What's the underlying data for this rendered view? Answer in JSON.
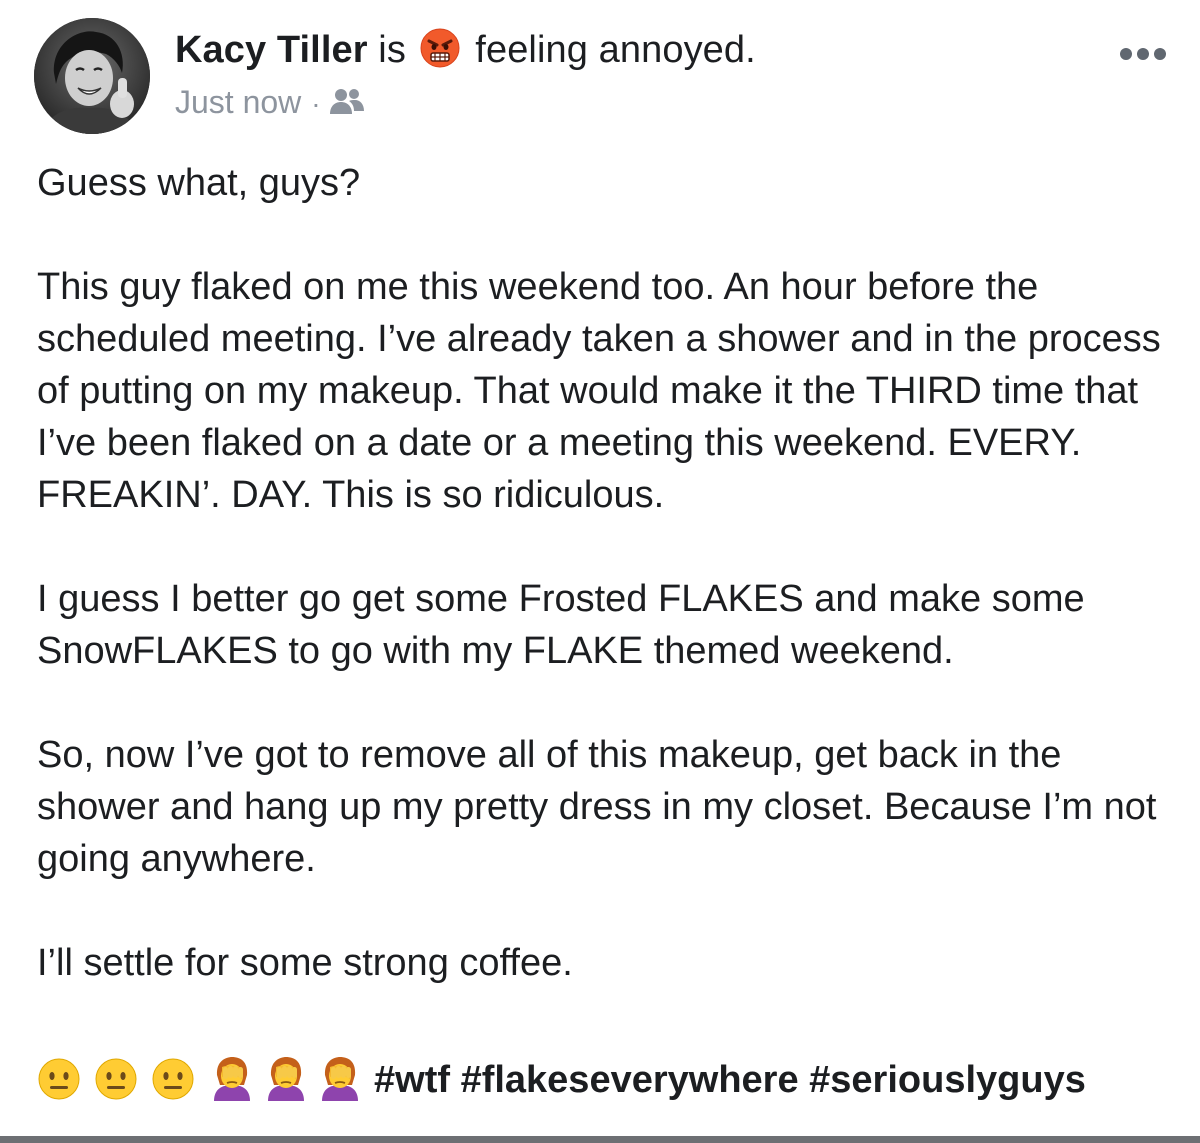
{
  "post": {
    "author": "Kacy Tiller",
    "feeling_prefix": "is",
    "feeling_text": "feeling annoyed.",
    "timestamp": "Just now",
    "separator": "·",
    "audience_icon": "friends-icon",
    "feeling_icon": "angry-face-emoji",
    "more_icon": "more-options-icon",
    "paragraphs": [
      "Guess what, guys?",
      "This guy flaked on me this weekend too. An hour before the scheduled meeting. I’ve already taken a shower and in the process of putting on my makeup. That would make it the THIRD time that I’ve been flaked on a date or a meeting this weekend. EVERY. FREAKIN’. DAY. This is so ridiculous.",
      "I guess I better go get some Frosted FLAKES and make some SnowFLAKES to go with my FLAKE themed weekend.",
      "So, now I’ve got to remove all of this makeup, get back in the shower and hang up my pretty dress in my closet. Because I’m not going anywhere.",
      "I’ll settle for some strong coffee."
    ],
    "final_emojis": [
      "neutral-face",
      "neutral-face",
      "neutral-face",
      "woman-facepalming",
      "woman-facepalming",
      "woman-facepalming"
    ],
    "hashtags": [
      "#wtf",
      "#flakeseverywhere",
      "#seriouslyguys"
    ]
  },
  "colors": {
    "text": "#1c1e21",
    "meta": "#8d949e",
    "emoji_yellow": "#ffcc33",
    "divider": "#6d6f73"
  }
}
